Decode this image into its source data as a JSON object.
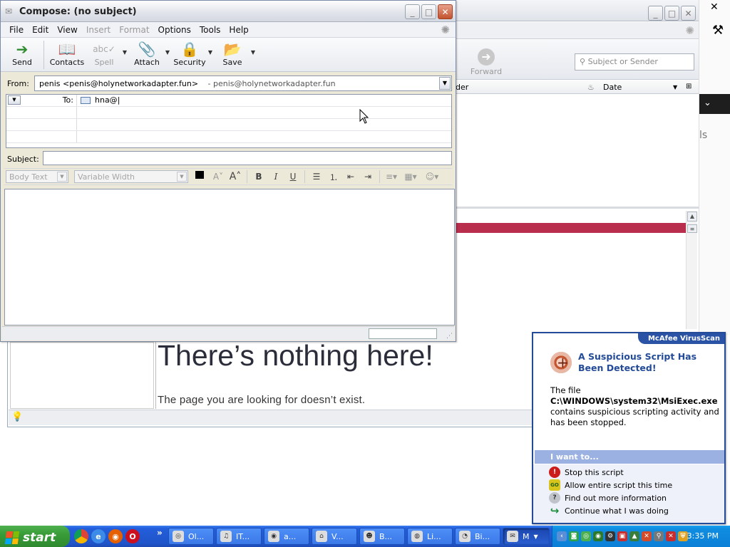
{
  "compose": {
    "title": "Compose: (no subject)",
    "menu": [
      "File",
      "Edit",
      "View",
      "Insert",
      "Format",
      "Options",
      "Tools",
      "Help"
    ],
    "toolbar": {
      "send": "Send",
      "contacts": "Contacts",
      "spell": "Spell",
      "attach": "Attach",
      "security": "Security",
      "save": "Save"
    },
    "from_label": "From:",
    "from_value": "penis <penis@holynetworkadapter.fun>",
    "from_alt": "- penis@holynetworkadapter.fun",
    "to_label": "To:",
    "to_value": "hna@",
    "subject_label": "Subject:",
    "subject_value": "",
    "format": {
      "paragraph": "Body Text",
      "font": "Variable Width"
    }
  },
  "background": {
    "forward_label": "Forward",
    "search_placeholder": "Subject or Sender",
    "col_sender": "nder",
    "col_date": "Date",
    "heading": "There’s nothing here!",
    "subtext": "The page you are looking for doesn’t exist.",
    "right_letters": "ls"
  },
  "mcafee": {
    "brand": "McAfee VirusScan",
    "headline": "A Suspicious Script Has Been Detected!",
    "body_intro": "The file",
    "body_path": "C:\\WINDOWS\\system32\\MsiExec.exe",
    "body_rest": "contains suspicious scripting activity and has been stopped.",
    "want_label": "I want to...",
    "actions": [
      "Stop this script",
      "Allow entire script this time",
      "Find out more information",
      "Continue what I was doing"
    ]
  },
  "taskbar": {
    "start_label": "start",
    "tasks": [
      "Ol...",
      "IT...",
      "a...",
      "V...",
      "B...",
      "Li...",
      "Bi...",
      "M"
    ],
    "clock": "3:35 PM"
  }
}
